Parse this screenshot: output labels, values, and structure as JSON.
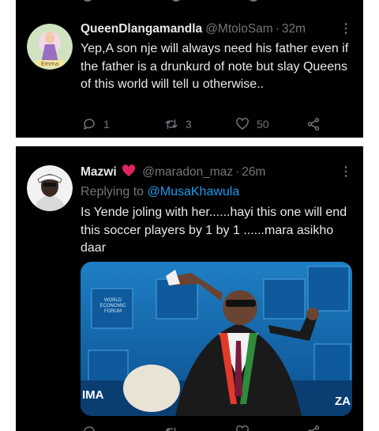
{
  "tweets": [
    {
      "display_name": "QueenDlangamandla",
      "handle": "@MtoloSam",
      "separator": "·",
      "time": "32m",
      "more": "⋮",
      "avatar_caption": "Emma",
      "text": "Yep,A son nje will always need his father even if the father is a drunkurd of note but slay Queens of this world will tell u otherwise..",
      "reply_count": "1",
      "retweet_count": "3",
      "like_count": "50"
    },
    {
      "display_name": "Mazwi",
      "name_emoji": "heart-bird-emoji",
      "handle": "@maradon_maz",
      "separator": "·",
      "time": "26m",
      "more": "⋮",
      "replying_to_label": "Replying to",
      "replying_to_handle": "@MusaKhawula",
      "text": "Is Yende joling with her......hayi this one will end this soccer players by 1 by 1 ......mara asikho daar",
      "media": {
        "type": "photo",
        "backdrop_text": [
          "WORLD",
          "ECONOMIC",
          "FORUM"
        ],
        "corner_left": "IMA",
        "corner_right": "ZA"
      }
    }
  ],
  "colors": {
    "background": "#000000",
    "text": "#e7e9ea",
    "muted": "#71767b",
    "link": "#1d9bf0",
    "name_emoji": "#e0245e"
  }
}
